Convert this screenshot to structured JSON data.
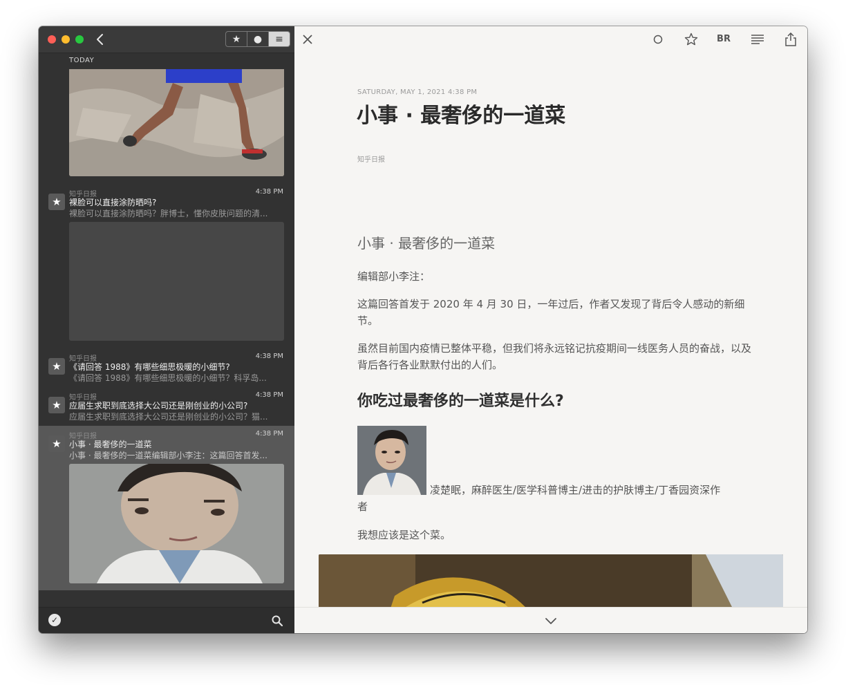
{
  "sidebar": {
    "section_label": "TODAY",
    "items": [
      {
        "source": "知乎日报",
        "time": "4:38 PM",
        "title": "裸脸可以直接涂防晒吗?",
        "snippet": "裸脸可以直接涂防晒吗？胖博士，懂你皮肤问题的清..."
      },
      {
        "source": "知乎日报",
        "time": "4:38 PM",
        "title": "《请回答 1988》有哪些细思极暖的小细节?",
        "snippet": "《请回答 1988》有哪些细思极暖的小细节？科孚岛..."
      },
      {
        "source": "知乎日报",
        "time": "4:38 PM",
        "title": "应届生求职到底选择大公司还是刚创业的小公司?",
        "snippet": "应届生求职到底选择大公司还是刚创业的小公司？猫..."
      },
      {
        "source": "知乎日报",
        "time": "4:38 PM",
        "title": "小事 · 最奢侈的一道菜",
        "snippet": "小事 · 最奢侈的一道菜编辑部小李注：这篇回答首发..."
      }
    ],
    "star_glyph": "★",
    "filter_segments": [
      "★",
      "●",
      "≡"
    ]
  },
  "reader": {
    "toolbar_icons": [
      "close-icon",
      "unread-circle-icon",
      "star-icon",
      "BR",
      "text-format-icon",
      "share-icon"
    ],
    "br_label": "BR",
    "date": "SATURDAY, MAY 1, 2021 4:38 PM",
    "title": "小事 · 最奢侈的一道菜",
    "source": "知乎日报",
    "subtitle": "小事 · 最奢侈的一道菜",
    "paragraphs": [
      "编辑部小李注：",
      "这篇回答首发于 2020 年 4 月 30 日，一年过后，作者又发现了背后令人感动的新细节。",
      "虽然目前国内疫情已整体平稳，但我们将永远铭记抗疫期间一线医务人员的奋战，以及背后各行各业默默付出的人们。"
    ],
    "heading": "你吃过最奢侈的一道菜是什么?",
    "author_line1": "凌楚眠，麻醉医生/医学科普博主/进击的护肤博主/丁香园资深作",
    "author_line2": "者",
    "after_author": "我想应该是这个菜。"
  },
  "colors": {
    "sidebar_bg": "#323232",
    "reader_bg": "#f6f5f3",
    "selected_row": "#585858"
  }
}
